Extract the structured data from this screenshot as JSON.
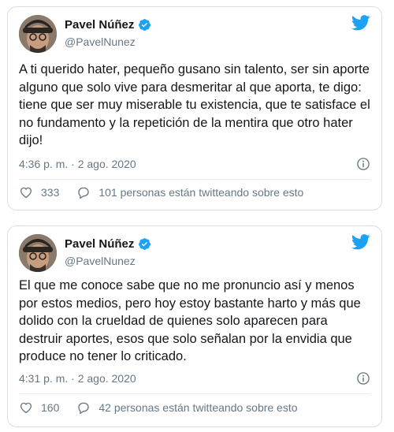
{
  "tweets": [
    {
      "name": "Pavel Núñez",
      "handle": "@PavelNunez",
      "text": "A ti querido hater, pequeño gusano sin talento, ser sin aporte alguno que solo vive para desmeritar al que aporta, te digo: tiene que ser muy miserable tu existencia, que te satisface el no fundamento y la repetición de la mentira que otro hater dijo!",
      "timestamp": "4:36 p. m. · 2 ago. 2020",
      "likes": "333",
      "conversation": "101 personas están twitteando sobre esto"
    },
    {
      "name": "Pavel Núñez",
      "handle": "@PavelNunez",
      "text": "El que me conoce sabe que no me pronuncio así y menos por estos medios, pero hoy estoy bastante harto y más que dolido con la crueldad de quienes solo aparecen para destruir aportes, esos que solo señalan por la envidia que produce no tener lo criticado.",
      "timestamp": "4:31 p. m. · 2 ago. 2020",
      "likes": "160",
      "conversation": "42 personas están twitteando sobre esto"
    }
  ],
  "icons": {
    "verified": "verified-badge-icon",
    "brand": "twitter-bird-icon",
    "info": "info-icon",
    "like": "heart-icon",
    "conversation": "speech-bubble-icon"
  },
  "colors": {
    "accent": "#1da1f2",
    "secondary_text": "#657786",
    "primary_text": "#14171a",
    "border": "#d8dee3"
  }
}
